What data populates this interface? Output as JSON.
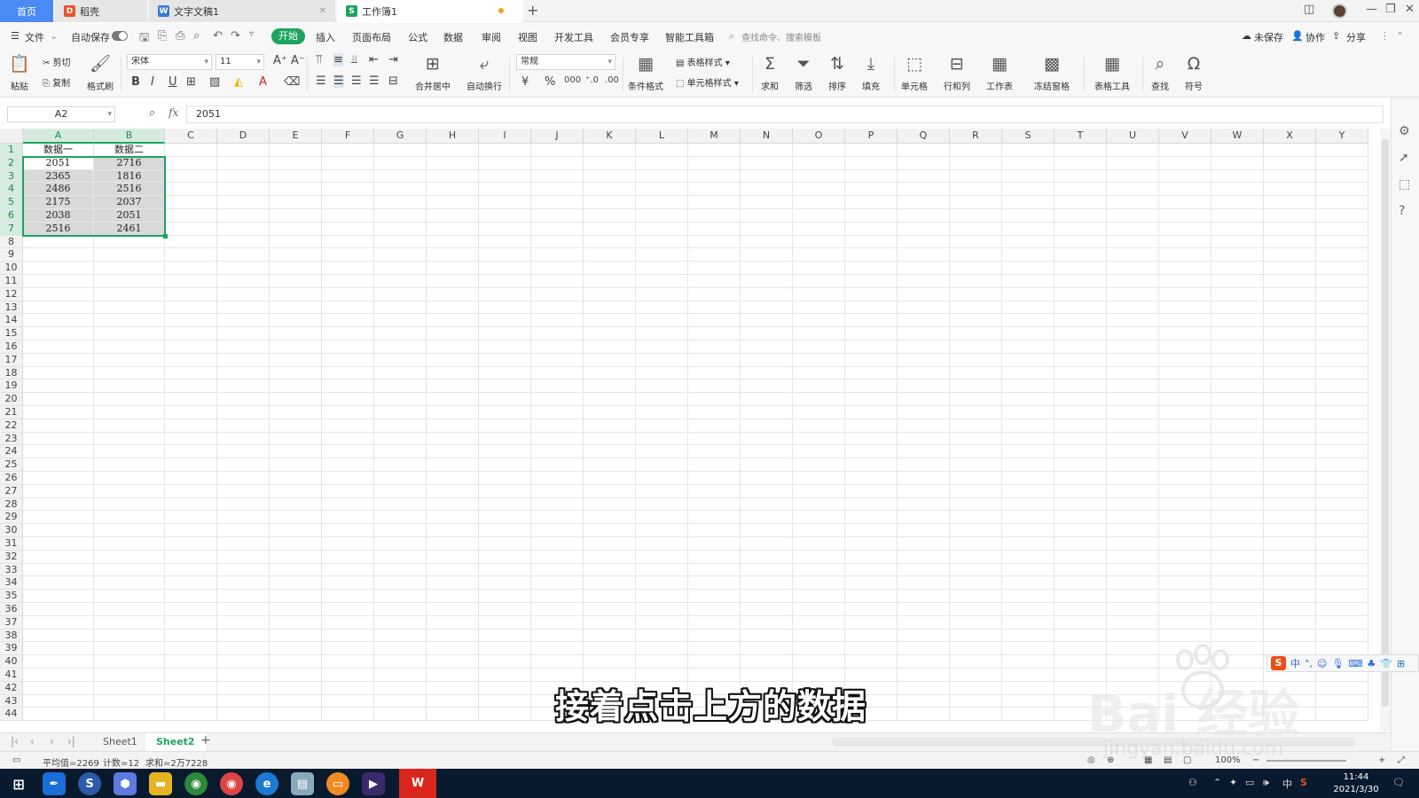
{
  "titlebar": {
    "tabs": [
      {
        "label": "首页",
        "icon": "home"
      },
      {
        "label": "稻壳",
        "icon": "docer-icon",
        "color": "#e8532a"
      },
      {
        "label": "文字文稿1",
        "icon": "word-doc-icon",
        "color": "#3a7bd5",
        "letter": "W"
      },
      {
        "label": "工作簿1",
        "icon": "spreadsheet-icon",
        "color": "#1ea35e",
        "letter": "S"
      }
    ],
    "new_tab": "+"
  },
  "menubar": {
    "file": "文件",
    "autosave": "自动保存",
    "items": [
      "开始",
      "插入",
      "页面布局",
      "公式",
      "数据",
      "审阅",
      "视图",
      "开发工具",
      "会员专享",
      "智能工具箱"
    ],
    "active": "开始",
    "search_placeholder": "查找命令、搜索模板",
    "unsaved": "未保存",
    "collab": "协作",
    "share": "分享"
  },
  "ribbon": {
    "paste": "粘贴",
    "cut": "剪切",
    "copy": "复制",
    "format_painter": "格式刷",
    "font_name": "宋体",
    "font_size": "11",
    "merge_center": "合并居中",
    "wrap_text": "自动换行",
    "number_format": "常规",
    "cond_format": "条件格式",
    "table_style": "表格样式",
    "cell_style": "单元格样式",
    "sum": "求和",
    "filter": "筛选",
    "sort": "排序",
    "fill": "填充",
    "cell": "单元格",
    "row_col": "行和列",
    "worksheet": "工作表",
    "freeze": "冻结窗格",
    "table_tools": "表格工具",
    "find": "查找",
    "symbol": "符号"
  },
  "formula": {
    "name_box": "A2",
    "value": "2051"
  },
  "grid": {
    "columns": [
      "A",
      "B",
      "C",
      "D",
      "E",
      "F",
      "G",
      "H",
      "I",
      "J",
      "K",
      "L",
      "M",
      "N",
      "O",
      "P",
      "Q",
      "R",
      "S",
      "T",
      "U",
      "V",
      "W",
      "X",
      "Y"
    ],
    "rows": 44,
    "headers": [
      "数据一",
      "数据二"
    ],
    "data": [
      [
        "2051",
        "2716"
      ],
      [
        "2365",
        "1816"
      ],
      [
        "2486",
        "2516"
      ],
      [
        "2175",
        "2037"
      ],
      [
        "2038",
        "2051"
      ],
      [
        "2516",
        "2461"
      ]
    ]
  },
  "sheets": {
    "tabs": [
      "Sheet1",
      "Sheet2"
    ],
    "active": "Sheet2"
  },
  "status": {
    "average": "平均值=2269",
    "count": "计数=12",
    "sum": "求和=2万7228",
    "zoom": "100%"
  },
  "taskbar": {
    "time": "11:44",
    "date": "2021/3/30",
    "ime_lang": "中"
  },
  "ime_bar": {
    "lang": "中"
  },
  "caption": "接着点击上方的数据",
  "watermark": {
    "text": "Bai 经验",
    "url": "jingyan.baidu.com"
  }
}
